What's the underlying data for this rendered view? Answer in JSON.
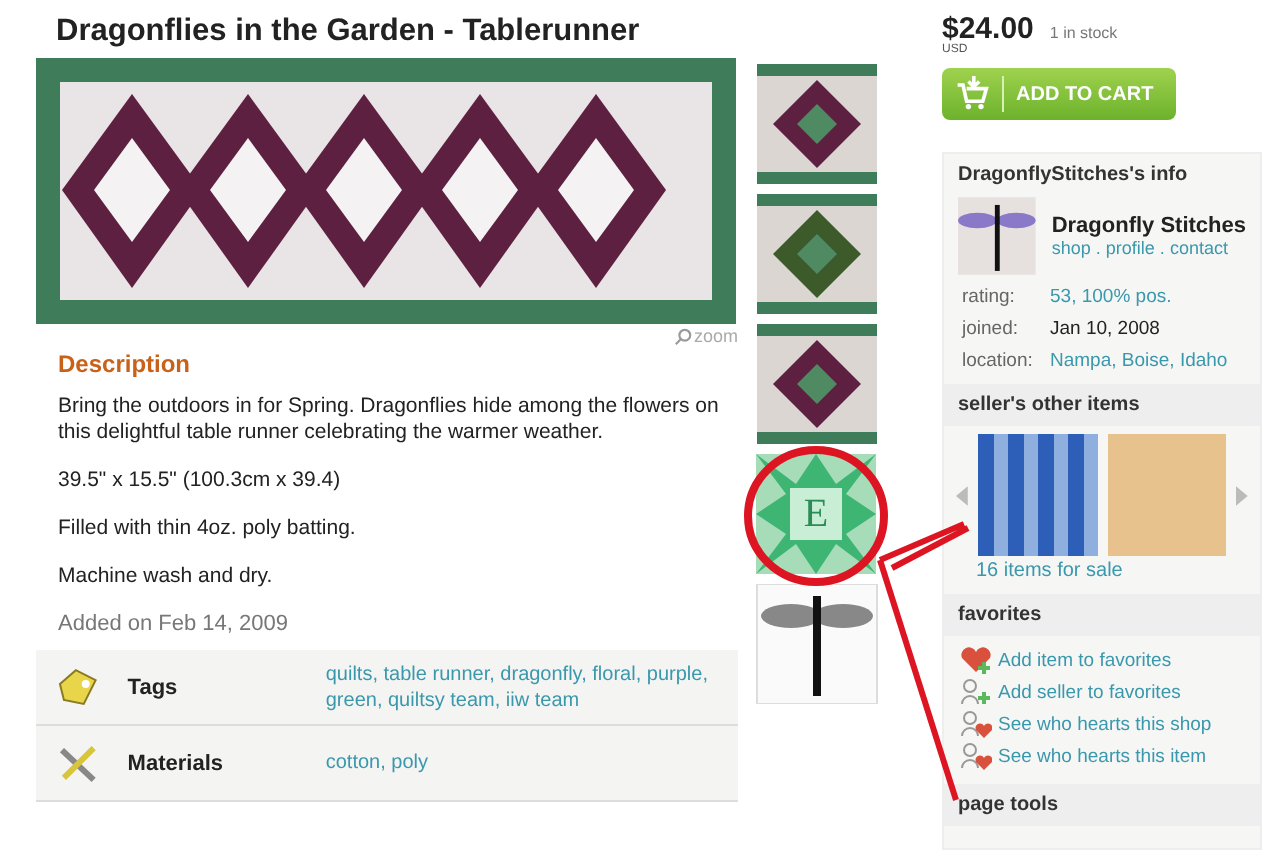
{
  "title": "Dragonflies in the Garden - Tablerunner",
  "zoom": "zoom",
  "thumbnails": [
    {
      "kind": "photo"
    },
    {
      "kind": "photo"
    },
    {
      "kind": "photo"
    },
    {
      "kind": "badge",
      "letter": "E"
    },
    {
      "kind": "sketch"
    }
  ],
  "description": {
    "heading": "Description",
    "paragraphs": [
      "Bring the outdoors in for Spring. Dragonflies hide among the flowers on this delightful table runner celebrating the warmer weather.",
      "39.5\" x 15.5\" (100.3cm x 39.4)",
      "Filled with thin 4oz. poly batting.",
      "Machine wash and dry."
    ],
    "added": "Added on Feb 14, 2009"
  },
  "details": [
    {
      "kind": "tags",
      "label": "Tags",
      "separator": ",",
      "links": [
        "quilts",
        "table runner",
        "dragonfly",
        "floral",
        "purple",
        "green",
        "quiltsy team",
        "iiw team"
      ]
    },
    {
      "kind": "materials",
      "label": "Materials",
      "separator": ",",
      "links": [
        "cotton",
        "poly"
      ]
    }
  ],
  "price": {
    "symbol": "$",
    "amount": "24.00",
    "currency": "USD",
    "stock": "1 in stock"
  },
  "add_to_cart": "ADD TO CART",
  "seller": {
    "heading": "DragonflyStitches's info",
    "name": "Dragonfly Stitches",
    "links": [
      "shop",
      "profile",
      "contact"
    ],
    "separator": ".",
    "facts": [
      {
        "label": "rating:",
        "value": "53, 100% pos.",
        "link": true
      },
      {
        "label": "joined:",
        "value": "Jan 10, 2008",
        "link": false
      },
      {
        "label": "location:",
        "value": "Nampa, Boise, Idaho",
        "link": true
      }
    ]
  },
  "other_items": {
    "heading": "seller's other items",
    "count": "16 items for sale"
  },
  "favorites": {
    "heading": "favorites",
    "items": [
      {
        "kind": "heart-add",
        "text": "Add item to favorites"
      },
      {
        "kind": "person-add",
        "text": "Add seller to favorites"
      },
      {
        "kind": "person-heart",
        "text": "See who hearts this shop"
      },
      {
        "kind": "person-heart",
        "text": "See who hearts this item"
      }
    ]
  },
  "page_tools": {
    "heading": "page tools"
  }
}
